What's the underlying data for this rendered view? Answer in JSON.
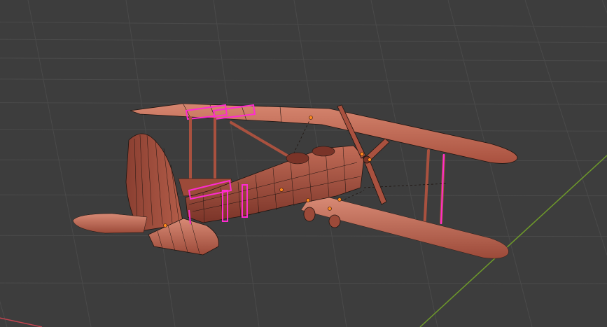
{
  "viewport": {
    "name": "3D Viewport",
    "background_color": "#3d3d3d",
    "grid_line_color": "#4a4a4a",
    "x_axis_color": "#c2434f",
    "y_axis_color": "#6e9a2a"
  },
  "model": {
    "object": "biplane",
    "surface_color": "#b8624f",
    "surface_shadow_color": "#7a3428",
    "surface_highlight_color": "#d88a75",
    "wire_color": "#1e1410",
    "selected_edge_color": "#ff2bd0",
    "origin_dot_color": "#ff8a1e",
    "origin_dot_count": 8
  }
}
